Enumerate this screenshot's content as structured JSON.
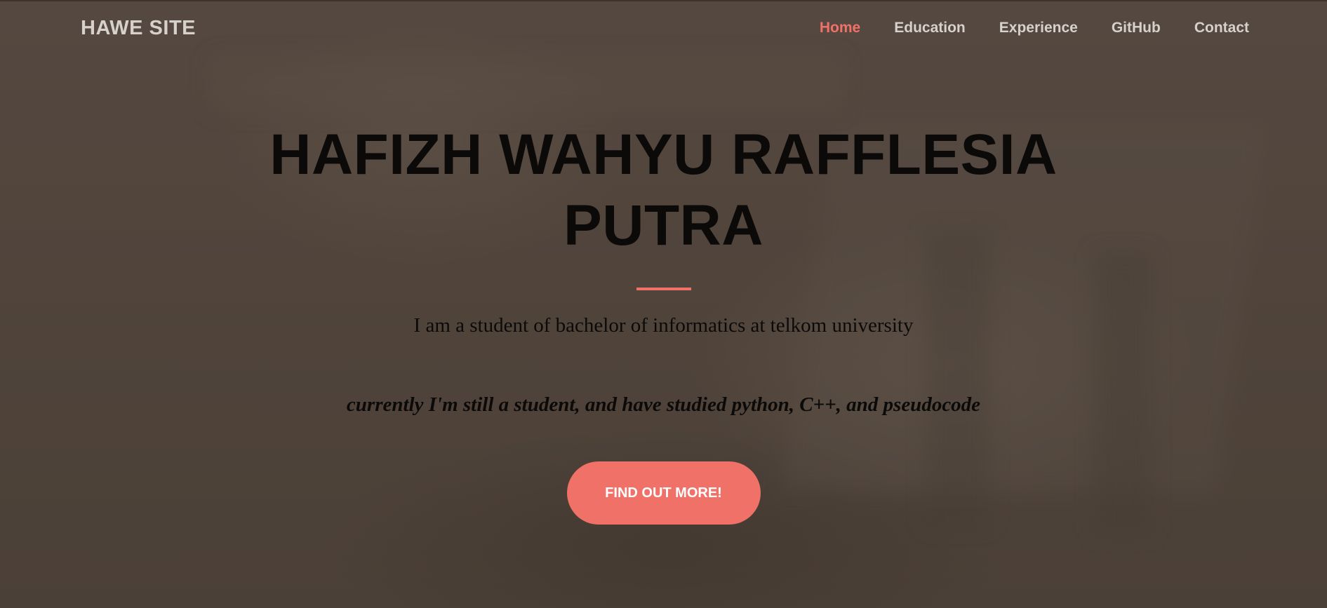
{
  "navbar": {
    "brand": "HAWE SITE",
    "links": [
      {
        "label": "Home",
        "active": true
      },
      {
        "label": "Education",
        "active": false
      },
      {
        "label": "Experience",
        "active": false
      },
      {
        "label": "GitHub",
        "active": false
      },
      {
        "label": "Contact",
        "active": false
      }
    ]
  },
  "hero": {
    "title": "HAFIZH WAHYU RAFFLESIA PUTRA",
    "subtitle": "I am a student of bachelor of informatics at telkom university",
    "tagline": "currently I'm still a student, and have studied python, C++, and pseudocode",
    "cta_label": "FIND OUT MORE!"
  },
  "colors": {
    "accent": "#f07167",
    "nav_text": "#d7d1cc",
    "hero_text": "#0b0a09",
    "background": "#4f433a"
  }
}
